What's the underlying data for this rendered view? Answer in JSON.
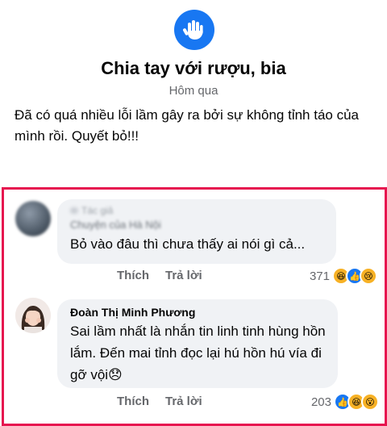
{
  "post": {
    "title": "Chia tay với rượu, bia",
    "time": "Hôm qua",
    "body": "Đã có quá nhiều lỗi lầm gây ra bởi sự không tỉnh táo của mình rồi. Quyết bỏ!!!",
    "icon": "waving-hand-icon",
    "accent": "#1877f2"
  },
  "highlight_color": "#e6154f",
  "comments": [
    {
      "author": "Chuyện của Hà Nội",
      "meta": "Tác giả",
      "text": "Bỏ vào đâu thì chưa thấy ai nói gì cả...",
      "like_label": "Thích",
      "reply_label": "Trả lời",
      "reaction_count": "371",
      "reactions": [
        "haha",
        "like",
        "sad"
      ]
    },
    {
      "author": "Đoàn Thị Minh Phương",
      "text": "Sai lầm nhất là nhắn tin linh tinh hùng hồn lắm. Đến mai tỉnh đọc lại hú hồn hú vía đi gỡ vội😞",
      "like_label": "Thích",
      "reply_label": "Trả lời",
      "reaction_count": "203",
      "reactions": [
        "like",
        "haha",
        "wow"
      ]
    }
  ]
}
